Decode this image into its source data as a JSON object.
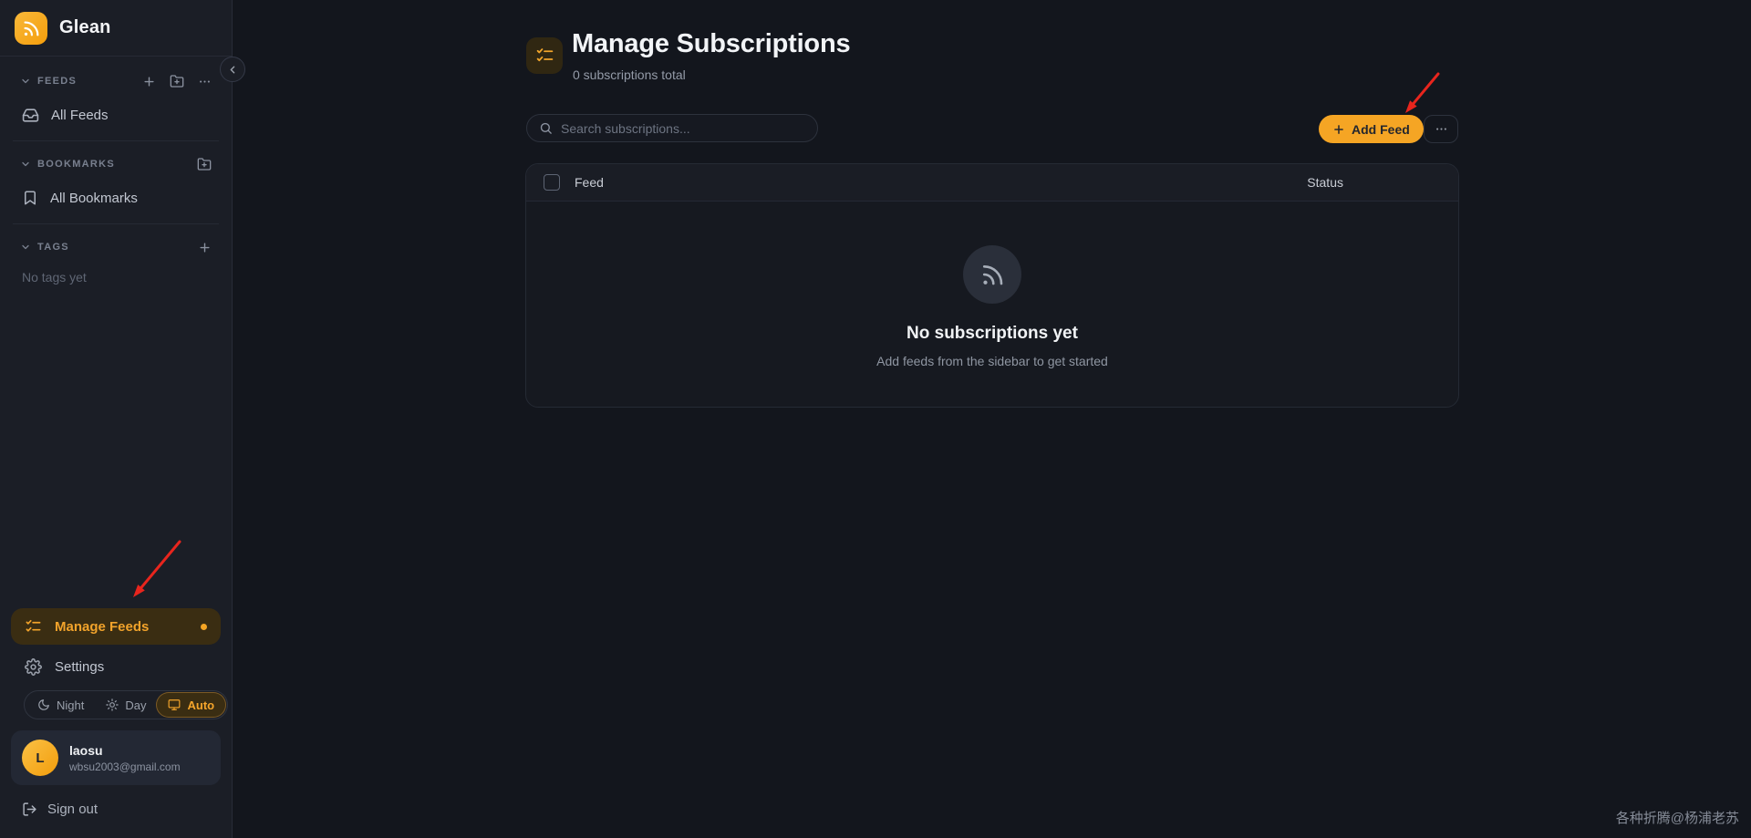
{
  "app": {
    "name": "Glean"
  },
  "sidebar": {
    "feeds_section": {
      "label": "FEEDS"
    },
    "all_feeds_label": "All Feeds",
    "bookmarks_section": {
      "label": "BOOKMARKS"
    },
    "all_bookmarks_label": "All Bookmarks",
    "tags_section": {
      "label": "TAGS"
    },
    "tags_empty": "No tags yet",
    "manage_feeds_label": "Manage Feeds",
    "settings_label": "Settings",
    "theme": {
      "night": "Night",
      "day": "Day",
      "auto": "Auto",
      "selected": "Auto"
    },
    "user": {
      "initial": "L",
      "name": "laosu",
      "email": "wbsu2003@gmail.com"
    },
    "sign_out_label": "Sign out"
  },
  "main": {
    "title": "Manage Subscriptions",
    "subtitle": "0 subscriptions total",
    "search_placeholder": "Search subscriptions...",
    "add_feed_label": "Add Feed",
    "table": {
      "columns": [
        "Feed",
        "Status"
      ],
      "rows": [],
      "empty_title": "No subscriptions yet",
      "empty_subtitle": "Add feeds from the sidebar to get started"
    }
  },
  "watermark": "各种折腾@杨浦老苏",
  "icons": {
    "logo": "rss",
    "section_collapse": "chevron-down",
    "add": "plus",
    "new_folder": "folder-plus",
    "more": "dots-horizontal",
    "all_feeds": "inbox",
    "all_bookmarks": "bookmark",
    "manage_feeds": "checklist",
    "settings": "gear",
    "night": "moon",
    "day": "sun",
    "auto": "monitor",
    "sign_out": "logout",
    "search": "magnifier",
    "empty_state": "rss",
    "sidebar_collapse": "chevron-left"
  },
  "colors": {
    "accent": "#f5a524",
    "accent_text_dark": "#23262e",
    "orange_text": "#f2a32b",
    "arrow_red": "#e8251d",
    "sidebar_bg": "#1b1e26",
    "main_bg": "#13161d"
  }
}
